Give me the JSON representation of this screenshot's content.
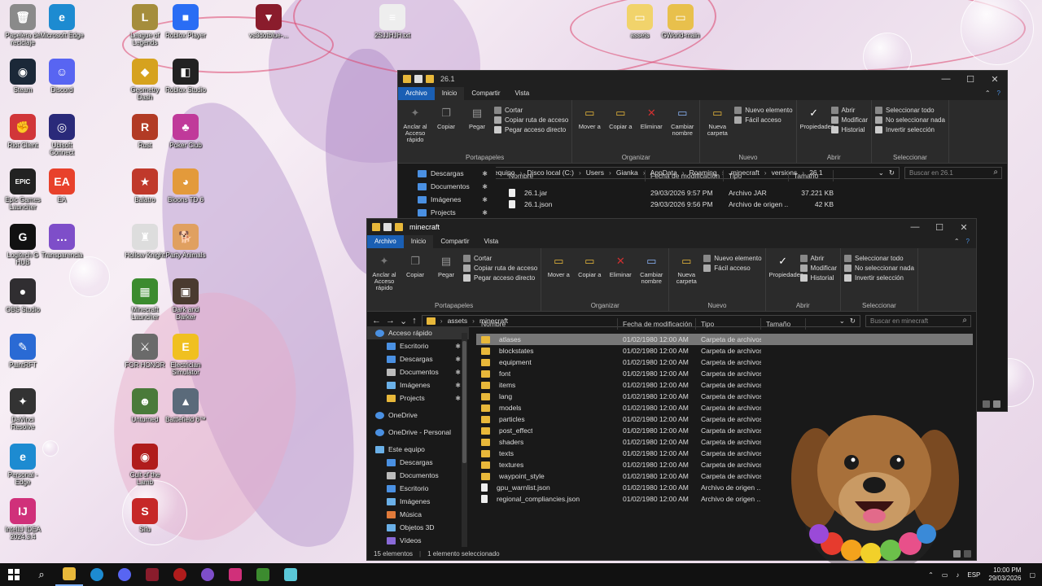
{
  "desktop": {
    "icons": [
      {
        "label": "Papelera de reciclaje",
        "glyph": "🗑",
        "color": "#8a8a8a"
      },
      {
        "label": "Microsoft Edge",
        "glyph": "e",
        "color": "#1d8bd1"
      },
      {
        "label": "League of Legends",
        "glyph": "L",
        "color": "#a58d3c"
      },
      {
        "label": "Roblox Player",
        "glyph": "■",
        "color": "#2a6df4"
      },
      {
        "label": "Steam",
        "glyph": "◉",
        "color": "#1b2838"
      },
      {
        "label": "Discord",
        "glyph": "☺",
        "color": "#5865f2"
      },
      {
        "label": "Geometry Dash",
        "glyph": "◆",
        "color": "#d6a21e"
      },
      {
        "label": "Roblox Studio",
        "glyph": "◧",
        "color": "#222"
      },
      {
        "label": "Riot Client",
        "glyph": "✊",
        "color": "#d13639"
      },
      {
        "label": "Ubisoft Connect",
        "glyph": "◎",
        "color": "#2a2a7a"
      },
      {
        "label": "Rust",
        "glyph": "R",
        "color": "#b23b25"
      },
      {
        "label": "Poker Club",
        "glyph": "♣",
        "color": "#c03a9a"
      },
      {
        "label": "Epic Games Launcher",
        "glyph": "EPIC",
        "color": "#222"
      },
      {
        "label": "EA",
        "glyph": "EA",
        "color": "#e8412b"
      },
      {
        "label": "Balatro",
        "glyph": "★",
        "color": "#c0392b"
      },
      {
        "label": "Bloons TD 6",
        "glyph": "◕",
        "color": "#e39a3b"
      },
      {
        "label": "Logitech G HUB",
        "glyph": "G",
        "color": "#111"
      },
      {
        "label": "Transparencia",
        "glyph": "…",
        "color": "#7e4ec9"
      },
      {
        "label": "Hollow Knight",
        "glyph": "♜",
        "color": "#ddd"
      },
      {
        "label": "Party Animals",
        "glyph": "🐕",
        "color": "#e0a060"
      },
      {
        "label": "OBS Studio",
        "glyph": "●",
        "color": "#302e31"
      },
      {
        "label": "Minecraft Launcher",
        "glyph": "▦",
        "color": "#3c8b2f"
      },
      {
        "label": "Dark and Darker",
        "glyph": "▣",
        "color": "#4a3b30"
      },
      {
        "label": "PaintRFT",
        "glyph": "✎",
        "color": "#2a6ad4"
      },
      {
        "label": "FOR HONOR",
        "glyph": "⚔",
        "color": "#6a6a6a"
      },
      {
        "label": "Electrician Simulator",
        "glyph": "E",
        "color": "#f0c020"
      },
      {
        "label": "DaVinci Resolve",
        "glyph": "✦",
        "color": "#333"
      },
      {
        "label": "Unturned",
        "glyph": "☻",
        "color": "#4a7a3a"
      },
      {
        "label": "Battlefield 6™",
        "glyph": "▲",
        "color": "#5a6a7a"
      },
      {
        "label": "Personal - Edge",
        "glyph": "e",
        "color": "#1d8bd1"
      },
      {
        "label": "Cult of the Lamb",
        "glyph": "◉",
        "color": "#b01c1c"
      },
      {
        "label": "IntelliJ IDEA 2024.3.4",
        "glyph": "IJ",
        "color": "#d0307a"
      },
      {
        "label": "Sifu",
        "glyph": "S",
        "color": "#c62828"
      },
      {
        "label": "vs3dotblue-...",
        "glyph": "▼",
        "color": "#8a1c2c"
      },
      {
        "label": "2SJJHJH.txt",
        "glyph": "≡",
        "color": "#eee"
      },
      {
        "label": "assets",
        "glyph": "▭",
        "color": "#f1d36b"
      },
      {
        "label": "GWorld-main",
        "glyph": "▭",
        "color": "#e8c04c"
      }
    ]
  },
  "back_window": {
    "title": "26.1",
    "tabs": [
      "Archivo",
      "Inicio",
      "Compartir",
      "Vista"
    ],
    "ribbon": {
      "portapapeles": {
        "name": "Portapapeles",
        "big": [
          "Anclar al Acceso rápido",
          "Copiar",
          "Pegar"
        ],
        "small": [
          "Cortar",
          "Copiar ruta de acceso",
          "Pegar acceso directo"
        ]
      },
      "organizar": {
        "name": "Organizar",
        "big": [
          "Mover a",
          "Copiar a",
          "Eliminar",
          "Cambiar nombre"
        ]
      },
      "nuevo": {
        "name": "Nuevo",
        "big": [
          "Nueva carpeta"
        ],
        "small": [
          "Nuevo elemento",
          "Fácil acceso"
        ]
      },
      "abrir": {
        "name": "Abrir",
        "big": [
          "Propiedades"
        ],
        "small": [
          "Abrir",
          "Modificar",
          "Historial"
        ]
      },
      "seleccionar": {
        "name": "Seleccionar",
        "small": [
          "Seleccionar todo",
          "No seleccionar nada",
          "Invertir selección"
        ]
      }
    },
    "path": [
      "Este equipo",
      "Disco local (C:)",
      "Users",
      "Gianka",
      "AppData",
      "Roaming",
      ".minecraft",
      "versions",
      "26.1"
    ],
    "search_placeholder": "Buscar en 26.1",
    "nav": [
      "Descargas",
      "Documentos",
      "Imágenes",
      "Projects"
    ],
    "columns": [
      "Nombre",
      "Fecha de modificación",
      "Tipo",
      "Tamaño"
    ],
    "files": [
      {
        "name": "26.1.jar",
        "date": "29/03/2026 9:57 PM",
        "type": "Archivo JAR",
        "size": "37.221 KB"
      },
      {
        "name": "26.1.json",
        "date": "29/03/2026 9:56 PM",
        "type": "Archivo de origen ...",
        "size": "42 KB"
      }
    ]
  },
  "front_window": {
    "title": "minecraft",
    "tabs": [
      "Archivo",
      "Inicio",
      "Compartir",
      "Vista"
    ],
    "ribbon": {
      "portapapeles": {
        "name": "Portapapeles",
        "big": [
          "Anclar al Acceso rápido",
          "Copiar",
          "Pegar"
        ],
        "small": [
          "Cortar",
          "Copiar ruta de acceso",
          "Pegar acceso directo"
        ]
      },
      "organizar": {
        "name": "Organizar",
        "big": [
          "Mover a",
          "Copiar a",
          "Eliminar",
          "Cambiar nombre"
        ]
      },
      "nuevo": {
        "name": "Nuevo",
        "big": [
          "Nueva carpeta"
        ],
        "small": [
          "Nuevo elemento",
          "Fácil acceso"
        ]
      },
      "abrir": {
        "name": "Abrir",
        "big": [
          "Propiedades"
        ],
        "small": [
          "Abrir",
          "Modificar",
          "Historial"
        ]
      },
      "seleccionar": {
        "name": "Seleccionar",
        "small": [
          "Seleccionar todo",
          "No seleccionar nada",
          "Invertir selección"
        ]
      }
    },
    "path": [
      "assets",
      "minecraft"
    ],
    "search_placeholder": "Buscar en minecraft",
    "nav": [
      {
        "label": "Acceso rápido",
        "level": "l1",
        "icon": "star",
        "pin": false,
        "selected": true
      },
      {
        "label": "Escritorio",
        "level": "l2",
        "icon": "desk",
        "pin": true
      },
      {
        "label": "Descargas",
        "level": "l2",
        "icon": "down",
        "pin": true
      },
      {
        "label": "Documentos",
        "level": "l2",
        "icon": "doc",
        "pin": true
      },
      {
        "label": "Imágenes",
        "level": "l2",
        "icon": "img",
        "pin": true
      },
      {
        "label": "Projects",
        "level": "l2",
        "icon": "folder",
        "pin": true
      },
      {
        "label": "",
        "level": "gap"
      },
      {
        "label": "OneDrive",
        "level": "l1",
        "icon": "cloud",
        "pin": false
      },
      {
        "label": "",
        "level": "gap"
      },
      {
        "label": "OneDrive - Personal",
        "level": "l1",
        "icon": "cloud",
        "pin": false
      },
      {
        "label": "",
        "level": "gap"
      },
      {
        "label": "Este equipo",
        "level": "l1",
        "icon": "pc",
        "pin": false
      },
      {
        "label": "Descargas",
        "level": "l2",
        "icon": "down",
        "pin": false
      },
      {
        "label": "Documentos",
        "level": "l2",
        "icon": "doc",
        "pin": false
      },
      {
        "label": "Escritorio",
        "level": "l2",
        "icon": "desk",
        "pin": false
      },
      {
        "label": "Imágenes",
        "level": "l2",
        "icon": "img",
        "pin": false
      },
      {
        "label": "Música",
        "level": "l2",
        "icon": "music",
        "pin": false
      },
      {
        "label": "Objetos 3D",
        "level": "l2",
        "icon": "cube",
        "pin": false
      },
      {
        "label": "Vídeos",
        "level": "l2",
        "icon": "video",
        "pin": false
      }
    ],
    "columns": [
      "Nombre",
      "Fecha de modificación",
      "Tipo",
      "Tamaño"
    ],
    "files": [
      {
        "name": "atlases",
        "date": "01/02/1980 12:00 AM",
        "type": "Carpeta de archivos",
        "size": "",
        "kind": "folder",
        "selected": true
      },
      {
        "name": "blockstates",
        "date": "01/02/1980 12:00 AM",
        "type": "Carpeta de archivos",
        "size": "",
        "kind": "folder"
      },
      {
        "name": "equipment",
        "date": "01/02/1980 12:00 AM",
        "type": "Carpeta de archivos",
        "size": "",
        "kind": "folder"
      },
      {
        "name": "font",
        "date": "01/02/1980 12:00 AM",
        "type": "Carpeta de archivos",
        "size": "",
        "kind": "folder"
      },
      {
        "name": "items",
        "date": "01/02/1980 12:00 AM",
        "type": "Carpeta de archivos",
        "size": "",
        "kind": "folder"
      },
      {
        "name": "lang",
        "date": "01/02/1980 12:00 AM",
        "type": "Carpeta de archivos",
        "size": "",
        "kind": "folder"
      },
      {
        "name": "models",
        "date": "01/02/1980 12:00 AM",
        "type": "Carpeta de archivos",
        "size": "",
        "kind": "folder"
      },
      {
        "name": "particles",
        "date": "01/02/1980 12:00 AM",
        "type": "Carpeta de archivos",
        "size": "",
        "kind": "folder"
      },
      {
        "name": "post_effect",
        "date": "01/02/1980 12:00 AM",
        "type": "Carpeta de archivos",
        "size": "",
        "kind": "folder"
      },
      {
        "name": "shaders",
        "date": "01/02/1980 12:00 AM",
        "type": "Carpeta de archivos",
        "size": "",
        "kind": "folder"
      },
      {
        "name": "texts",
        "date": "01/02/1980 12:00 AM",
        "type": "Carpeta de archivos",
        "size": "",
        "kind": "folder"
      },
      {
        "name": "textures",
        "date": "01/02/1980 12:00 AM",
        "type": "Carpeta de archivos",
        "size": "",
        "kind": "folder"
      },
      {
        "name": "waypoint_style",
        "date": "01/02/1980 12:00 AM",
        "type": "Carpeta de archivos",
        "size": "",
        "kind": "folder"
      },
      {
        "name": "gpu_warnlist.json",
        "date": "01/02/1980 12:00 AM",
        "type": "Archivo de origen ...",
        "size": "1 K",
        "kind": "file"
      },
      {
        "name": "regional_compliancies.json",
        "date": "01/02/1980 12:00 AM",
        "type": "Archivo de origen ...",
        "size": "",
        "kind": "file"
      }
    ],
    "status": {
      "count": "15 elementos",
      "selection": "1 elemento seleccionado"
    }
  },
  "taskbar": {
    "lang": "ESP",
    "time": "10:00 PM",
    "date": "29/03/2026"
  },
  "colors": {
    "accent": "#1a5fb4",
    "folder": "#e8b83a",
    "window_bg": "#191919",
    "ribbon_bg": "#2b2b2b"
  }
}
